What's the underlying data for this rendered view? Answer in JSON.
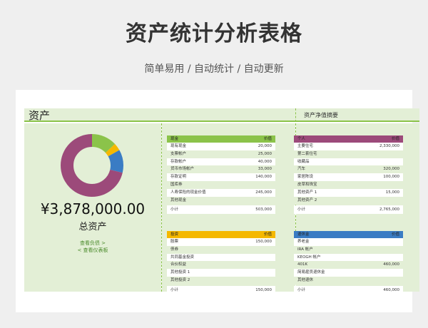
{
  "header": {
    "title": "资产统计分析表格",
    "subtitle": "简单易用  /  自动统计  /  自动更新"
  },
  "sheet": {
    "section_left": "资产",
    "section_right": "资产净值摘要",
    "total_amount": "¥3,878,000.00",
    "total_label": "总资产",
    "link_liabilities": "查看负债 >",
    "link_dashboard": "< 查看仪表板"
  },
  "colors": {
    "green": "#8bc34a",
    "purple": "#9c4a7a",
    "orange": "#f5b800",
    "blue": "#3a7cc4",
    "light_green": "#e3efd6"
  },
  "donut": {
    "segments": [
      {
        "value": 503000,
        "color": "#8bc34a"
      },
      {
        "value": 150000,
        "color": "#f5b800"
      },
      {
        "value": 460000,
        "color": "#3a7cc4"
      },
      {
        "value": 2765000,
        "color": "#9c4a7a"
      }
    ]
  },
  "tables": {
    "cash": {
      "title": "现金",
      "value_header": "价值",
      "head_color": "#8bc34a",
      "rows": [
        {
          "label": "现有现金",
          "value": "20,000"
        },
        {
          "label": "支票帐户",
          "value": "25,000"
        },
        {
          "label": "存款帐户",
          "value": "40,000"
        },
        {
          "label": "货币市场帐户",
          "value": "33,000"
        },
        {
          "label": "存款证明",
          "value": "140,000"
        },
        {
          "label": "国库券",
          "value": ""
        },
        {
          "label": "人寿保险的现金价值",
          "value": "245,000"
        },
        {
          "label": "其他现金",
          "value": ""
        }
      ],
      "subtotal_label": "小计",
      "subtotal_value": "503,000"
    },
    "personal": {
      "title": "个人",
      "value_header": "价值",
      "head_color": "#9c4a7a",
      "rows": [
        {
          "label": "主要住宅",
          "value": "2,330,000"
        },
        {
          "label": "第二套住宅",
          "value": ""
        },
        {
          "label": "收藏品",
          "value": ""
        },
        {
          "label": "汽车",
          "value": "320,000"
        },
        {
          "label": "家居陈设",
          "value": "100,000"
        },
        {
          "label": "皮草和珠宝",
          "value": ""
        },
        {
          "label": "其他资产 1",
          "value": "15,000"
        },
        {
          "label": "其他资产 2",
          "value": ""
        }
      ],
      "subtotal_label": "小计",
      "subtotal_value": "2,765,000"
    },
    "invest": {
      "title": "投资",
      "value_header": "价值",
      "head_color": "#f5b800",
      "rows": [
        {
          "label": "股票",
          "value": "150,000"
        },
        {
          "label": "债券",
          "value": ""
        },
        {
          "label": "共同基金投资",
          "value": ""
        },
        {
          "label": "合伙权益",
          "value": ""
        },
        {
          "label": "其他投资 1",
          "value": ""
        },
        {
          "label": "其他投资 2",
          "value": ""
        }
      ],
      "subtotal_label": "小计",
      "subtotal_value": "150,000"
    },
    "retire": {
      "title": "退休金",
      "value_header": "价值",
      "head_color": "#3a7cc4",
      "rows": [
        {
          "label": "养老金",
          "value": ""
        },
        {
          "label": "IRA 帐户",
          "value": ""
        },
        {
          "label": "KEOGH 帐户",
          "value": ""
        },
        {
          "label": "401K",
          "value": "460,000"
        },
        {
          "label": "简易雇员退休金",
          "value": ""
        },
        {
          "label": "其他退休",
          "value": ""
        }
      ],
      "subtotal_label": "小计",
      "subtotal_value": "460,000"
    }
  }
}
